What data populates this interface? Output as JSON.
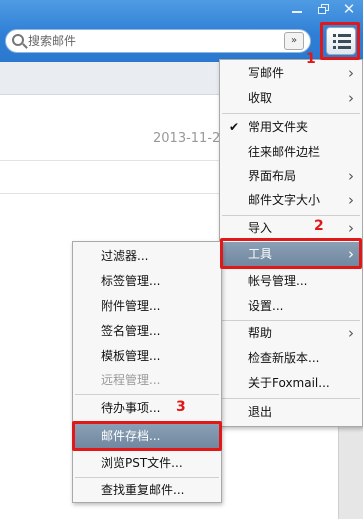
{
  "window": {
    "minimize_icon": "minimize-icon",
    "restore_icon": "restore-icon",
    "close_glyph": "✕"
  },
  "search": {
    "placeholder": "搜索邮件",
    "dropdown_glyph": "»"
  },
  "background": {
    "date": "2013-11-2"
  },
  "annotations": {
    "n1": "1",
    "n2": "2",
    "n3": "3",
    "color": "#e01818"
  },
  "main_menu": {
    "items": [
      {
        "label": "写邮件",
        "arrow": "›"
      },
      {
        "label": "收取",
        "arrow": "›"
      },
      {
        "label": "常用文件夹",
        "check": "✔"
      },
      {
        "label": "往来邮件边栏"
      },
      {
        "label": "界面布局",
        "arrow": "›"
      },
      {
        "label": "邮件文字大小",
        "arrow": "›"
      },
      {
        "label": "导入",
        "arrow": "›"
      },
      {
        "label": "工具",
        "arrow": "›"
      },
      {
        "label": "帐号管理..."
      },
      {
        "label": "设置..."
      },
      {
        "label": "帮助",
        "arrow": "›"
      },
      {
        "label": "检查新版本..."
      },
      {
        "label": "关于Foxmail..."
      },
      {
        "label": "退出"
      }
    ]
  },
  "tools_submenu": {
    "items": [
      {
        "label": "过滤器..."
      },
      {
        "label": "标签管理..."
      },
      {
        "label": "附件管理..."
      },
      {
        "label": "签名管理..."
      },
      {
        "label": "模板管理..."
      },
      {
        "label": "远程管理..."
      },
      {
        "label": "待办事项..."
      },
      {
        "label": "邮件存档..."
      },
      {
        "label": "浏览PST文件..."
      },
      {
        "label": "查找重复邮件..."
      }
    ]
  },
  "colors": {
    "titlebar": "#2f7fd6",
    "highlight": "#7890a8",
    "annotation_red": "#e01818"
  }
}
